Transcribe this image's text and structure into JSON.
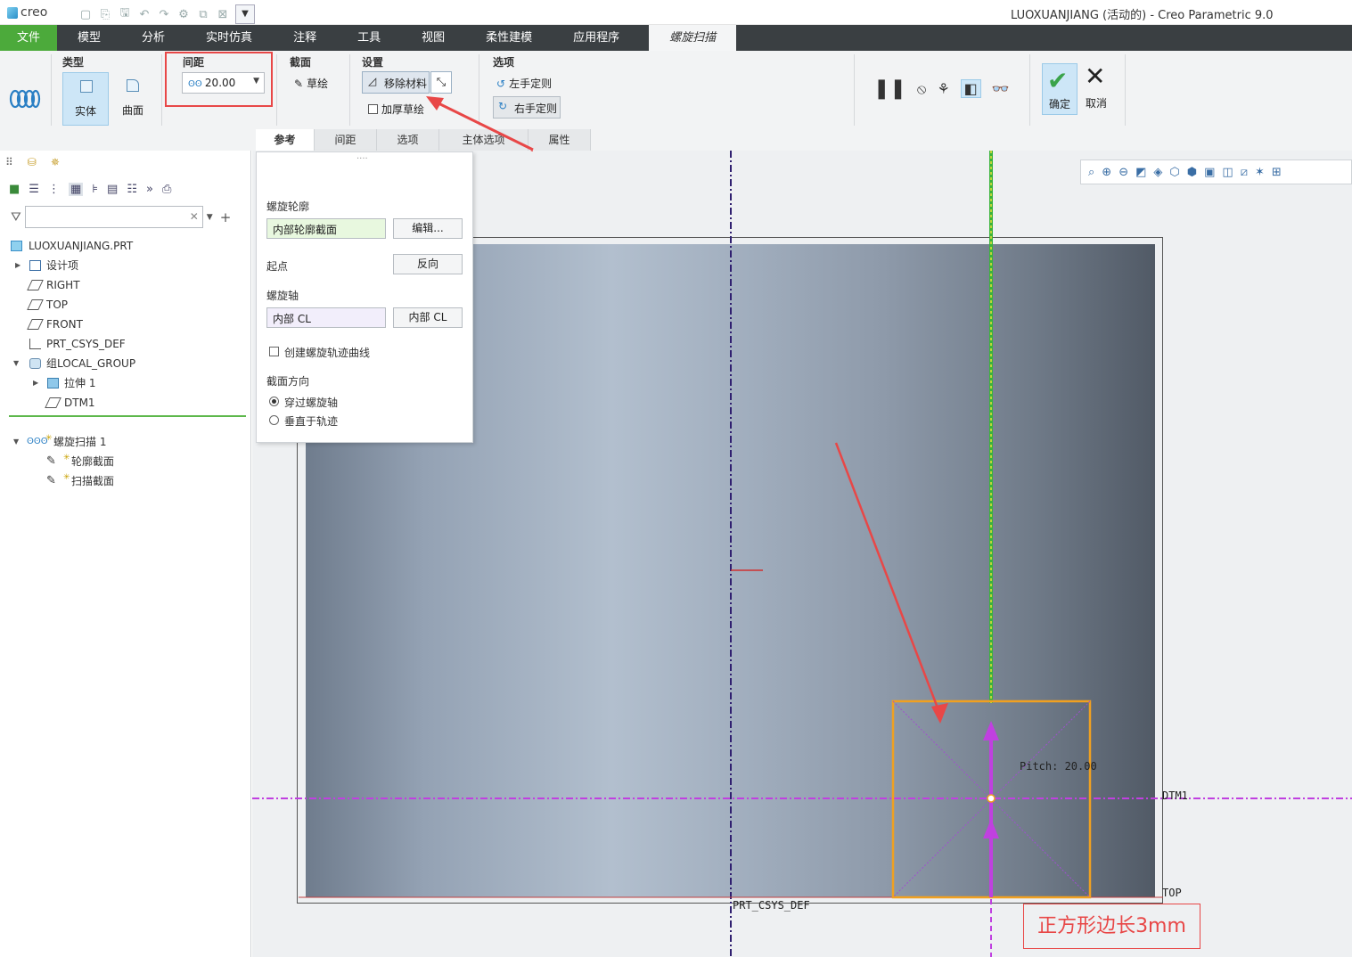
{
  "titlebar": {
    "logo": "creo",
    "title": "LUOXUANJIANG (活动的) - Creo Parametric 9.0"
  },
  "menu": [
    "文件",
    "模型",
    "分析",
    "实时仿真",
    "注释",
    "工具",
    "视图",
    "柔性建模",
    "应用程序",
    "螺旋扫描"
  ],
  "ribbon": {
    "type_group": "类型",
    "solid": "实体",
    "surface": "曲面",
    "pitch_group": "间距",
    "pitch_value": "20.00",
    "section_group": "截面",
    "sketch": "草绘",
    "settings_group": "设置",
    "remove_material": "移除材料",
    "thicken_sketch": "加厚草绘",
    "options_group": "选项",
    "left_hand": "左手定则",
    "right_hand": "右手定则",
    "ok": "确定",
    "cancel": "取消"
  },
  "tabs": [
    "参考",
    "间距",
    "选项",
    "主体选项",
    "属性"
  ],
  "dash": {
    "profile_label": "螺旋轮廓",
    "profile_value": "内部轮廓截面",
    "edit_button": "编辑...",
    "start_label": "起点",
    "flip_button": "反向",
    "axis_label": "螺旋轴",
    "axis_value": "内部 CL",
    "axis_button": "内部 CL",
    "create_curve": "创建螺旋轨迹曲线",
    "section_orient_label": "截面方向",
    "through_axis": "穿过螺旋轴",
    "normal_traj": "垂直于轨迹"
  },
  "tree": [
    {
      "label": "LUOXUANJIANG.PRT",
      "level": 0
    },
    {
      "label": "设计项",
      "level": 1
    },
    {
      "label": "RIGHT",
      "level": 1
    },
    {
      "label": "TOP",
      "level": 1
    },
    {
      "label": "FRONT",
      "level": 1
    },
    {
      "label": "PRT_CSYS_DEF",
      "level": 1
    },
    {
      "label": "组LOCAL_GROUP",
      "level": 1
    },
    {
      "label": "拉伸 1",
      "level": 2
    },
    {
      "label": "DTM1",
      "level": 2
    },
    {
      "label": "螺旋扫描 1",
      "level": 1
    },
    {
      "label": "轮廓截面",
      "level": 2
    },
    {
      "label": "扫描截面",
      "level": 2
    }
  ],
  "viewport": {
    "pitch_text": "Pitch: 20.00",
    "dtm1": "DTM1",
    "top": "TOP",
    "csys": "PRT_CSYS_DEF",
    "annotation": "正方形边长3mm"
  },
  "colors": {
    "file_tab": "#4caa3b",
    "menubar": "#3a3f42",
    "highlight": "#e84747",
    "section_box": "#f0a020",
    "axis_magenta": "#c040e0"
  }
}
